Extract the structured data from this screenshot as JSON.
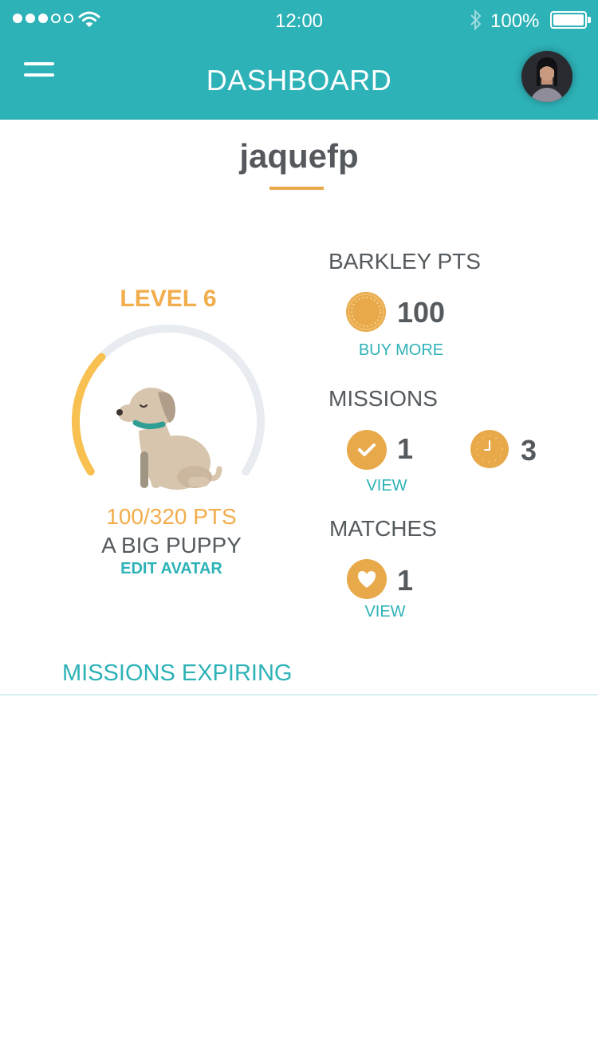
{
  "status_bar": {
    "time": "12:00",
    "battery_percent": "100%",
    "signal_bars": 3
  },
  "header": {
    "title": "DASHBOARD",
    "menu_icon": "hamburger-menu-icon",
    "profile_icon": "profile-avatar"
  },
  "profile": {
    "username": "jaquefp"
  },
  "avatar_card": {
    "level_label": "LEVEL 6",
    "points_progress": "100/320 PTS",
    "progress_fraction": 0.3125,
    "avatar_name": "A BIG PUPPY",
    "edit_label": "EDIT AVATAR",
    "avatar_icon": "puppy-icon"
  },
  "barkley": {
    "label": "BARKLEY PTS",
    "value": "100",
    "link": "BUY MORE",
    "icon": "coin-icon"
  },
  "missions": {
    "label": "MISSIONS",
    "completed_value": "1",
    "pending_value": "3",
    "link": "VIEW",
    "completed_icon": "check-icon",
    "pending_icon": "clock-icon"
  },
  "matches": {
    "label": "MATCHES",
    "value": "1",
    "link": "VIEW",
    "icon": "heart-icon"
  },
  "missions_expiring": {
    "label": "MISSIONS EXPIRING"
  },
  "colors": {
    "primary": "#2db2b7",
    "accent": "#e8a94a",
    "text": "#555a5e",
    "track": "#e8ecf1"
  }
}
